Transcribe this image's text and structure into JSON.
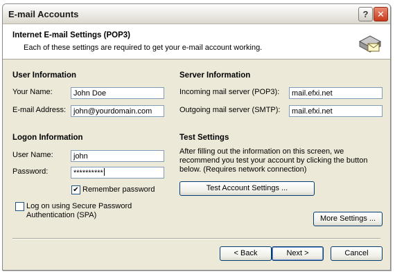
{
  "window": {
    "title": "E-mail Accounts",
    "help_glyph": "?",
    "close_glyph": "✕"
  },
  "header": {
    "title": "Internet E-mail Settings (POP3)",
    "subtitle": "Each of these settings are required to get your e-mail account working."
  },
  "user_info": {
    "heading": "User Information",
    "name_label": "Your Name:",
    "name_value": "John Doe",
    "email_label": "E-mail Address:",
    "email_value": "john@yourdomain.com"
  },
  "server_info": {
    "heading": "Server Information",
    "incoming_label": "Incoming mail server (POP3):",
    "incoming_value": "mail.efxi.net",
    "outgoing_label": "Outgoing mail server (SMTP):",
    "outgoing_value": "mail.efxi.net"
  },
  "logon_info": {
    "heading": "Logon Information",
    "username_label": "User Name:",
    "username_value": "john",
    "password_label": "Password:",
    "password_value": "**********",
    "remember_label": "Remember password",
    "remember_checked": true,
    "spa_label_line1": "Log on using Secure Password",
    "spa_label_line2": "Authentication (SPA)",
    "spa_checked": false
  },
  "test_settings": {
    "heading": "Test Settings",
    "desc_line1": "After filling out the information on this screen, we",
    "desc_line2": "recommend you test your account by clicking the button",
    "desc_line3": "below. (Requires network connection)",
    "test_button": "Test Account Settings ..."
  },
  "buttons": {
    "more_settings": "More Settings ...",
    "back": "< Back",
    "next": "Next >",
    "cancel": "Cancel"
  },
  "icons": {
    "checkmark": "✔"
  }
}
